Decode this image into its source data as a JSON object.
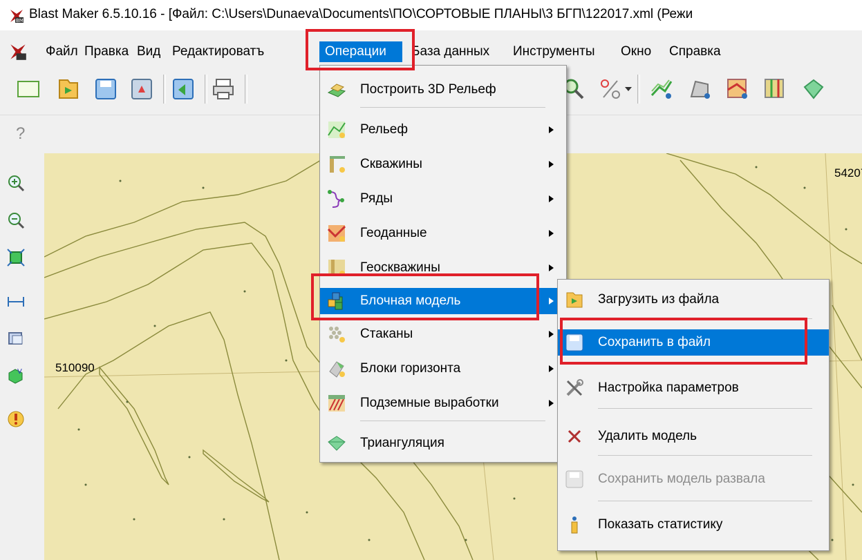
{
  "window": {
    "title": "Blast Maker 6.5.10.16 - [Файл: C:\\Users\\Dunaeva\\Documents\\ПО\\СОРТОВЫЕ ПЛАНЫ\\3 БГП\\122017.xml (Режи"
  },
  "menubar": {
    "items": [
      {
        "label": "Файл"
      },
      {
        "label": "Правка"
      },
      {
        "label": "Вид"
      },
      {
        "label": "Редактироватъ"
      },
      {
        "label": "Операции"
      },
      {
        "label": "База данных"
      },
      {
        "label": "Инструменты"
      },
      {
        "label": "Окно"
      },
      {
        "label": "Справка"
      }
    ]
  },
  "toolbar2": {
    "help_label": "?"
  },
  "map": {
    "labels": [
      {
        "text": "510090"
      },
      {
        "text": "54207"
      }
    ]
  },
  "operations_menu": {
    "items": [
      {
        "label": "Построить 3D Рельеф",
        "icon": "build-3d-relief-icon",
        "submenu": false
      },
      {
        "label": "Рельеф",
        "icon": "relief-icon",
        "submenu": true
      },
      {
        "label": "Скважины",
        "icon": "wells-icon",
        "submenu": true
      },
      {
        "label": "Ряды",
        "icon": "rows-icon",
        "submenu": true
      },
      {
        "label": "Геоданные",
        "icon": "geodata-icon",
        "submenu": true
      },
      {
        "label": "Геоскважины",
        "icon": "geowells-icon",
        "submenu": true
      },
      {
        "label": "Блочная модель",
        "icon": "block-model-icon",
        "submenu": true,
        "highlighted": true
      },
      {
        "label": "Стаканы",
        "icon": "cups-icon",
        "submenu": true
      },
      {
        "label": "Блоки горизонта",
        "icon": "horizon-blocks-icon",
        "submenu": true
      },
      {
        "label": "Подземные выработки",
        "icon": "underground-workings-icon",
        "submenu": true
      },
      {
        "label": "Триангуляция",
        "icon": "triangulation-icon",
        "submenu": false
      }
    ]
  },
  "block_model_submenu": {
    "items": [
      {
        "label": "Загрузить из файла",
        "icon": "folder-open-icon",
        "enabled": true
      },
      {
        "label": "Сохранить в файл",
        "icon": "save-disk-icon",
        "enabled": true,
        "highlighted": true
      },
      {
        "label": "Настройка параметров",
        "icon": "tools-icon",
        "enabled": true
      },
      {
        "label": "Удалить модель",
        "icon": "delete-x-icon",
        "enabled": true
      },
      {
        "label": "Сохранить модель развала",
        "icon": "save-disk-disabled-icon",
        "enabled": false
      },
      {
        "label": "Показать статистику",
        "icon": "info-icon",
        "enabled": true
      }
    ]
  },
  "colors": {
    "highlight": "#0078d7",
    "annotation_red": "#e0202a",
    "map_background": "#efe6b0",
    "map_lines": "#8a8a3c",
    "grid_lines": "#c8b878"
  }
}
